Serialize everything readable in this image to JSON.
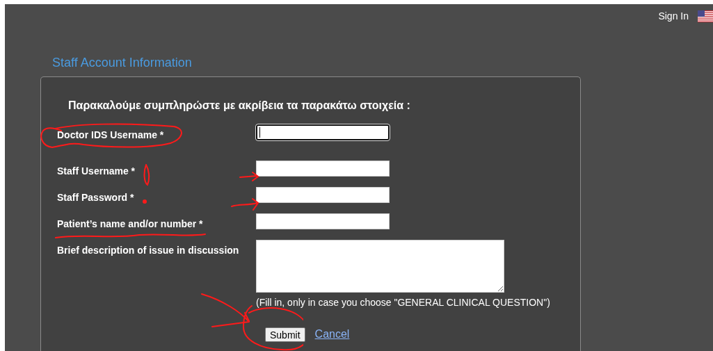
{
  "top_bar": {
    "sign_in": "Sign In"
  },
  "section_title": "Staff Account Information",
  "form": {
    "heading": "Παρακαλούμε συμπληρώστε με ακρίβεια τα παρακάτω στοιχεία :",
    "fields": [
      {
        "label": "Doctor IDS Username *",
        "kind": "text",
        "focused": true
      },
      {
        "label": "Staff Username *",
        "kind": "text",
        "focused": false
      },
      {
        "label": "Staff Password *",
        "kind": "password",
        "focused": false
      },
      {
        "label": "Patient’s name and/or number *",
        "kind": "text",
        "focused": false
      },
      {
        "label": "Brief description of issue in discussion",
        "kind": "textarea",
        "focused": false
      }
    ],
    "hint": "(Fill in, only in case you choose \"GENERAL CLINICAL QUESTION\")",
    "submit": "Submit",
    "cancel": "Cancel"
  }
}
